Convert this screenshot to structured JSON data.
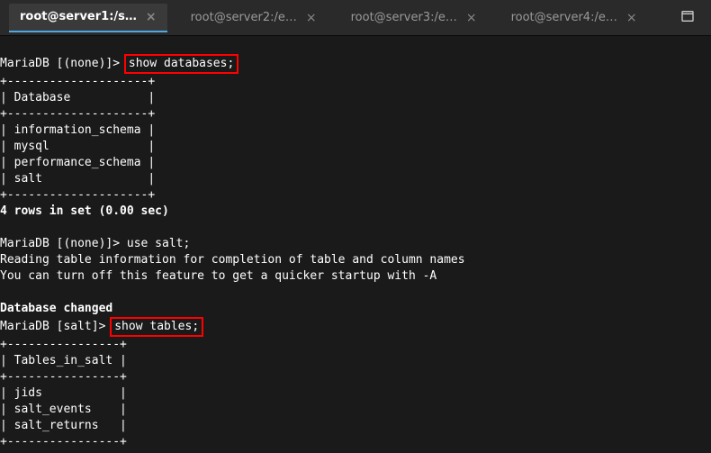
{
  "tabs": [
    {
      "label": "root@server1:/s…",
      "active": true
    },
    {
      "label": "root@server2:/e…",
      "active": false
    },
    {
      "label": "root@server3:/e…",
      "active": false
    },
    {
      "label": "root@server4:/e…",
      "active": false
    }
  ],
  "terminal": {
    "prompt1_prefix": "MariaDB [(none)]> ",
    "cmd1": "show databases;",
    "db_border": "+--------------------+",
    "db_header": "| Database           |",
    "db_rows": [
      "| information_schema |",
      "| mysql              |",
      "| performance_schema |",
      "| salt               |"
    ],
    "rows_summary1": "4 rows in set (0.00 sec)",
    "prompt2_line": "MariaDB [(none)]> use salt;",
    "reading_line": "Reading table information for completion of table and column names",
    "turnoff_line": "You can turn off this feature to get a quicker startup with -A",
    "db_changed": "Database changed",
    "prompt3_prefix": "MariaDB [salt]> ",
    "cmd2": "show tables;",
    "tbl_border": "+----------------+",
    "tbl_header": "| Tables_in_salt |",
    "tbl_rows": [
      "| jids           |",
      "| salt_events    |",
      "| salt_returns   |"
    ]
  }
}
